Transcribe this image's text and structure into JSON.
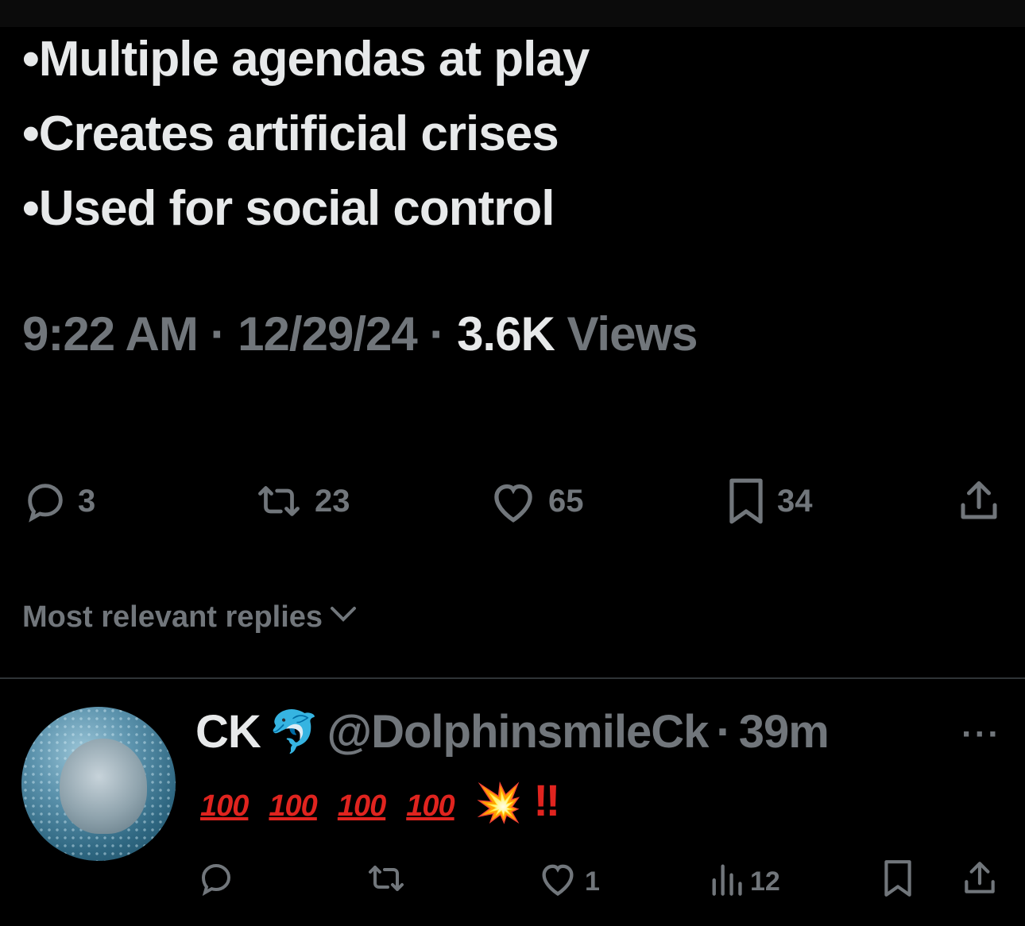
{
  "tweet": {
    "bullets": [
      "•Multiple agendas at play",
      "•Creates artificial crises",
      "•Used for social control"
    ],
    "time": "9:22 AM",
    "date": "12/29/24",
    "views_count": "3.6K",
    "views_label": "Views",
    "separator": "·",
    "actions": {
      "replies": "3",
      "reposts": "23",
      "likes": "65",
      "bookmarks": "34"
    }
  },
  "replies_sort": {
    "label": "Most relevant replies"
  },
  "reply": {
    "name": "CK",
    "name_emoji": "🐬",
    "handle": "@DolphinsmileCk",
    "separator": "·",
    "time": "39m",
    "more": "···",
    "hundred": "100",
    "boom": "💥",
    "bang": "‼",
    "actions": {
      "likes": "1",
      "views": "12"
    }
  },
  "colors": {
    "background": "#000000",
    "text": "#e7e9ea",
    "muted": "#71767b",
    "divider": "#2f3336",
    "emoji_red": "#e0241f"
  }
}
